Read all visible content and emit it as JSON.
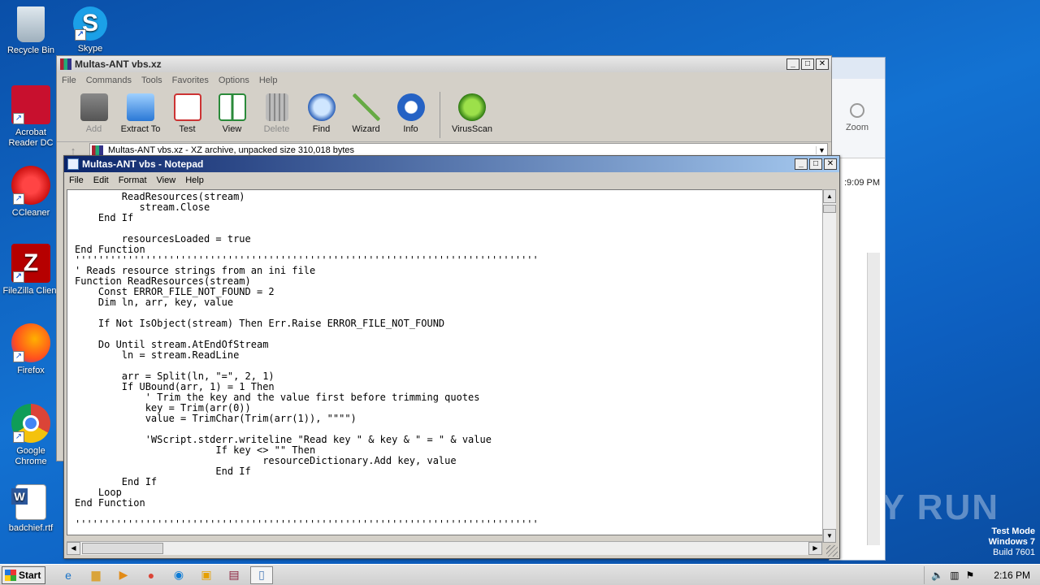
{
  "desktop": {
    "icons": [
      {
        "label": "Recycle Bin"
      },
      {
        "label": "Skype"
      },
      {
        "label": "Acrobat Reader DC"
      },
      {
        "label": "CCleaner"
      },
      {
        "label": "FileZilla Client"
      },
      {
        "label": "Firefox"
      },
      {
        "label": "Google Chrome"
      },
      {
        "label": "badchief.rtf"
      }
    ],
    "watermark": "ANY RUN",
    "test_mode": {
      "line1": "Test Mode",
      "line2": "Windows 7",
      "line3": "Build 7601"
    }
  },
  "bg_window": {
    "ribbon_label": "Zoom",
    "ribbon_label2": "oom",
    "time": ":9:09 PM"
  },
  "winrar": {
    "title": "Multas-ANT vbs.xz",
    "menu": [
      "File",
      "Commands",
      "Tools",
      "Favorites",
      "Options",
      "Help"
    ],
    "toolbar": [
      {
        "label": "Add",
        "icon": "add-icon"
      },
      {
        "label": "Extract To",
        "icon": "extract-icon"
      },
      {
        "label": "Test",
        "icon": "test-icon"
      },
      {
        "label": "View",
        "icon": "view-icon"
      },
      {
        "label": "Delete",
        "icon": "delete-icon"
      },
      {
        "label": "Find",
        "icon": "find-icon"
      },
      {
        "label": "Wizard",
        "icon": "wizard-icon"
      },
      {
        "label": "Info",
        "icon": "info-icon"
      },
      {
        "label": "VirusScan",
        "icon": "virusscan-icon"
      }
    ],
    "path": "Multas-ANT vbs.xz - XZ archive, unpacked size 310,018 bytes"
  },
  "notepad": {
    "title": "Multas-ANT vbs - Notepad",
    "menu": [
      "File",
      "Edit",
      "Format",
      "View",
      "Help"
    ],
    "content": "        ReadResources(stream)\n           stream.Close\n    End If\n\n        resourcesLoaded = true\nEnd Function\n'''''''''''''''''''''''''''''''''''''''''''''''''''''''''''''''''''''''''''''''\n' Reads resource strings from an ini file\nFunction ReadResources(stream)\n    Const ERROR_FILE_NOT_FOUND = 2\n    Dim ln, arr, key, value\n\n    If Not IsObject(stream) Then Err.Raise ERROR_FILE_NOT_FOUND\n\n    Do Until stream.AtEndOfStream\n        ln = stream.ReadLine\n\n        arr = Split(ln, \"=\", 2, 1)\n        If UBound(arr, 1) = 1 Then\n            ' Trim the key and the value first before trimming quotes\n            key = Trim(arr(0))\n            value = TrimChar(Trim(arr(1)), \"\"\"\")\n\n            'WScript.stderr.writeline \"Read key \" & key & \" = \" & value\n                        If key <> \"\" Then\n                                resourceDictionary.Add key, value\n                        End If\n        End If\n    Loop\nEnd Function\n\n'''''''''''''''''''''''''''''''''''''''''''''''''''''''''''''''''''''''''''''''"
  },
  "taskbar": {
    "start_label": "Start",
    "clock": "2:16 PM"
  }
}
